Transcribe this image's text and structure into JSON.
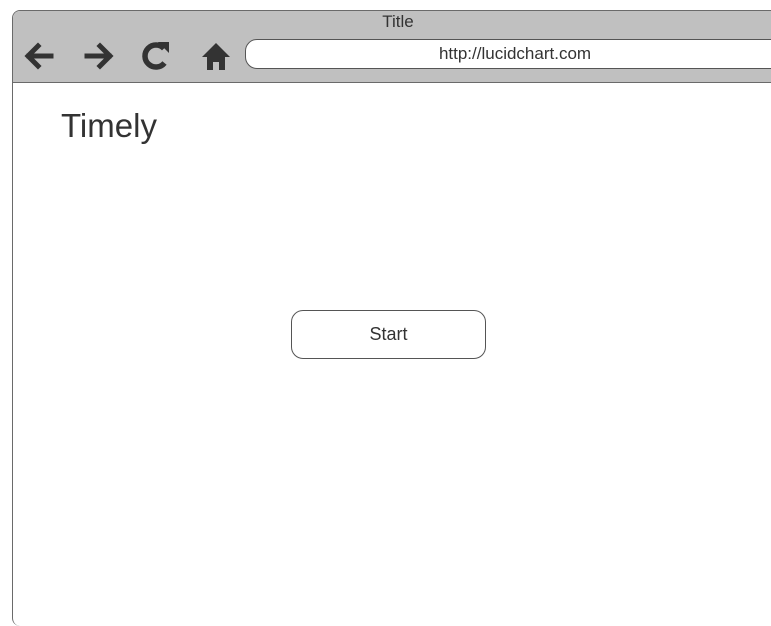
{
  "browser": {
    "window_title": "Title",
    "address_url": "http://lucidchart.com",
    "toolbar_icons": [
      "back-arrow-icon",
      "forward-arrow-icon",
      "reload-icon",
      "home-icon"
    ],
    "chrome_color": "#c0c0c0",
    "border_color": "#6a6a6a"
  },
  "page": {
    "title": "Timely",
    "start_button_label": "Start",
    "text_color": "#333333",
    "background": "#ffffff"
  }
}
